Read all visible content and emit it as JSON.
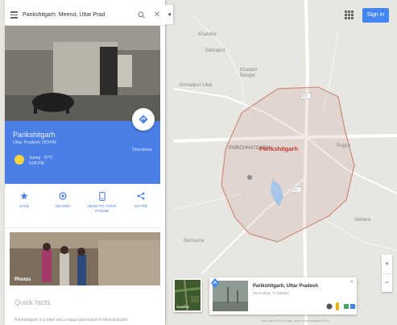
{
  "search": {
    "value": "Parikshitgarh, Meerut, Uttar Prad"
  },
  "header": {
    "signin_label": "Sign in"
  },
  "place": {
    "name": "Parikshitgarh",
    "subtitle": "Uttar Pradesh 250406",
    "weather_line1": "Sunny · 37°C",
    "weather_line2": "5:06 PM",
    "directions_label": "Directions"
  },
  "actions": [
    {
      "label": "SAVE"
    },
    {
      "label": "NEARBY"
    },
    {
      "label": "SEND TO YOUR PHONE"
    },
    {
      "label": "SHARE"
    }
  ],
  "photos": {
    "label": "Photos"
  },
  "quick_facts": {
    "title": "Quick facts",
    "text": "Parikshitgarh is a town and a nagar panchayat in Meerut district"
  },
  "map": {
    "labels": {
      "city": "Parikshitgarh",
      "l1": "Khandur",
      "l2": "Kharpur Bangar",
      "l3": "Ahmadpur Ukla",
      "l4": "PARICHHATGARH",
      "l5": "Rajpur",
      "l6": "Bahsuma",
      "l7": "Sikhera",
      "l8": "Bahrapur"
    },
    "road_labels": [
      "324",
      "324"
    ],
    "satellite_label": "Satellite",
    "footer": "Map data ©2019 Google    Terms    Send feedback    500 m"
  },
  "mini_card": {
    "title": "Parikshitgarh, Uttar Pradesh",
    "coords": "28.973919, 77.935981"
  },
  "zoom": {
    "plus": "+",
    "minus": "−"
  },
  "colors": {
    "brand_blue": "#4285f4",
    "panel_blue": "#4a7fe6",
    "boundary": "#c98b7f"
  }
}
